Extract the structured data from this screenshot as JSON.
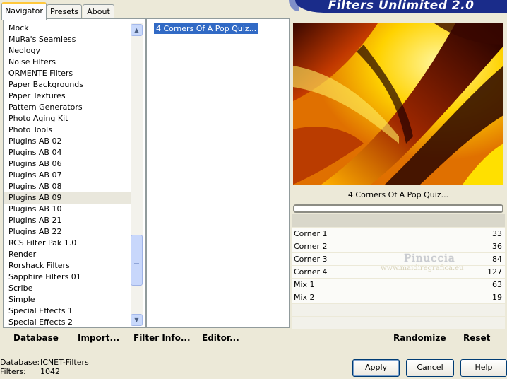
{
  "tabs": [
    "Navigator",
    "Presets",
    "About"
  ],
  "brand_title": "Filters Unlimited 2.0",
  "categories": [
    "Mock",
    "MuRa's Seamless",
    "Neology",
    "Noise Filters",
    "ORMENTE Filters",
    "Paper Backgrounds",
    "Paper Textures",
    "Pattern Generators",
    "Photo Aging Kit",
    "Photo Tools",
    "Plugins AB 02",
    "Plugins AB 04",
    "Plugins AB 06",
    "Plugins AB 07",
    "Plugins AB 08",
    "Plugins AB 09",
    "Plugins AB 10",
    "Plugins AB 21",
    "Plugins AB 22",
    "RCS Filter Pak 1.0",
    "Render",
    "Rorshack Filters",
    "Sapphire Filters 01",
    "Scribe",
    "Simple",
    "Special Effects 1",
    "Special Effects 2"
  ],
  "selected_category": "Plugins AB 09",
  "selected_filter": "4 Corners Of A Pop Quiz...",
  "preview_title": "4 Corners Of A Pop Quiz...",
  "params": [
    {
      "name": "Corner 1",
      "value": "33"
    },
    {
      "name": "Corner 2",
      "value": "36"
    },
    {
      "name": "Corner 3",
      "value": "84"
    },
    {
      "name": "Corner 4",
      "value": "127"
    },
    {
      "name": "Mix 1",
      "value": "63"
    },
    {
      "name": "Mix 2",
      "value": "19"
    }
  ],
  "watermark": {
    "line1": "Pinuccia",
    "line2": "www.maidiregrafica.eu"
  },
  "links": {
    "database": "Database",
    "import": "Import...",
    "filter_info": "Filter Info...",
    "editor": "Editor...",
    "randomize": "Randomize",
    "reset": "Reset"
  },
  "status": {
    "database_label": "Database:",
    "database_value": "ICNET-Filters",
    "filters_label": "Filters:",
    "filters_value": "1042"
  },
  "buttons": {
    "apply": "Apply",
    "cancel": "Cancel",
    "help": "Help"
  }
}
